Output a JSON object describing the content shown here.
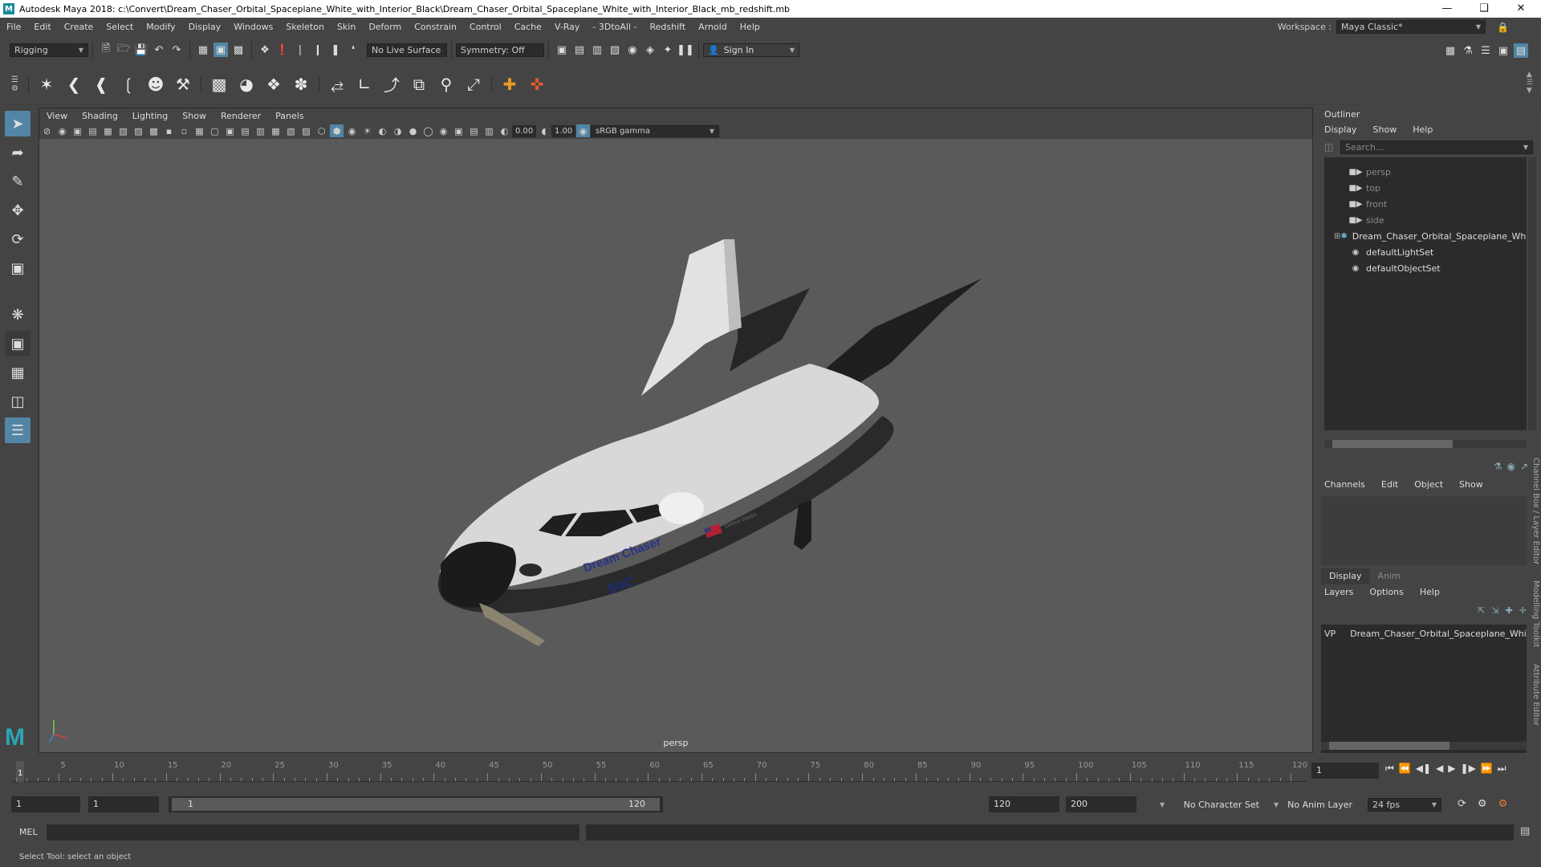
{
  "titlebar": {
    "app_icon": "maya-logo-icon",
    "title": "Autodesk Maya 2018: c:\\Convert\\Dream_Chaser_Orbital_Spaceplane_White_with_Interior_Black\\Dream_Chaser_Orbital_Spaceplane_White_with_Interior_Black_mb_redshift.mb"
  },
  "menubar": {
    "items": [
      "File",
      "Edit",
      "Create",
      "Select",
      "Modify",
      "Display",
      "Windows",
      "Skeleton",
      "Skin",
      "Deform",
      "Constrain",
      "Control",
      "Cache",
      "V-Ray",
      "3DtoAll",
      "Redshift",
      "Arnold",
      "Help"
    ],
    "workspace_label": "Workspace :",
    "workspace_value": "Maya Classic*"
  },
  "statusline": {
    "mode": "Rigging",
    "live_surface": "No Live Surface",
    "symmetry": "Symmetry: Off",
    "sign_in": "Sign In"
  },
  "viewport": {
    "menu": [
      "View",
      "Shading",
      "Lighting",
      "Show",
      "Renderer",
      "Panels"
    ],
    "exposure": "0.00",
    "gamma": "1.00",
    "color_space": "sRGB gamma",
    "camera_name": "persp",
    "model_texts": {
      "brand": "Dream Chaser",
      "logo": "SNC",
      "flag_text": "United States"
    }
  },
  "outliner": {
    "title": "Outliner",
    "menu": [
      "Display",
      "Show",
      "Help"
    ],
    "search_placeholder": "Search...",
    "items": [
      {
        "label": "persp",
        "icon": "camera-icon",
        "dim": true
      },
      {
        "label": "top",
        "icon": "camera-icon",
        "dim": true
      },
      {
        "label": "front",
        "icon": "camera-icon",
        "dim": true
      },
      {
        "label": "side",
        "icon": "camera-icon",
        "dim": true
      },
      {
        "label": "Dream_Chaser_Orbital_Spaceplane_White_with_Interior_Black",
        "icon": "transform-icon",
        "dim": false
      },
      {
        "label": "defaultLightSet",
        "icon": "set-icon",
        "dim": false
      },
      {
        "label": "defaultObjectSet",
        "icon": "set-icon",
        "dim": false
      }
    ]
  },
  "channelbox": {
    "menu": [
      "Channels",
      "Edit",
      "Object",
      "Show"
    ]
  },
  "layereditor": {
    "tabs": [
      "Display",
      "Anim"
    ],
    "menu": [
      "Layers",
      "Options",
      "Help"
    ],
    "layer": {
      "v": "V",
      "p": "P",
      "name": "Dream_Chaser_Orbital_Spaceplane_White_with_Interior_Black",
      "color": "#c0162f"
    }
  },
  "sidetabs": [
    "Channel Box / Layer Editor",
    "Modelling Toolkit",
    "Attribute Editor"
  ],
  "timeline": {
    "ticks": [
      "5",
      "10",
      "15",
      "20",
      "25",
      "30",
      "35",
      "40",
      "45",
      "50",
      "55",
      "60",
      "65",
      "70",
      "75",
      "80",
      "85",
      "90",
      "95",
      "100",
      "105",
      "110",
      "115",
      "120"
    ],
    "current_frame_marker": "1",
    "current_frame": "1"
  },
  "range": {
    "start": "1",
    "playback_start": "1",
    "slider_start": "1",
    "slider_end": "120",
    "playback_end": "120",
    "end": "200",
    "character_set": "No Character Set",
    "anim_layer": "No Anim Layer",
    "fps": "24 fps"
  },
  "cmdline": {
    "label": "MEL"
  },
  "helpline": {
    "text": "Select Tool: select an object"
  },
  "colors": {
    "accent": "#5285a6",
    "panel": "#444444",
    "field": "#2b2b2b",
    "viewport": "#5a5a5a"
  }
}
